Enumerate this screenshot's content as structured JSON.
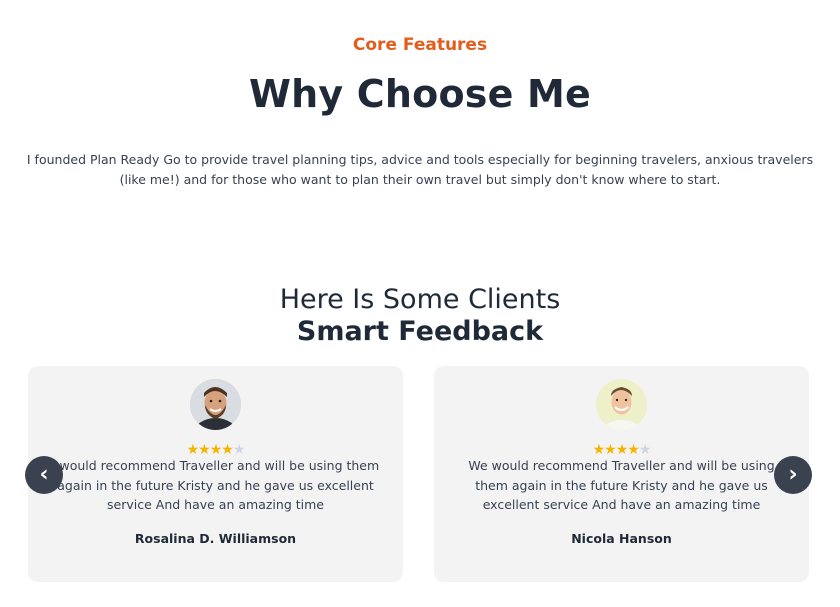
{
  "features": {
    "eyebrow": "Core Features",
    "title": "Why Choose Me",
    "description": "I founded Plan Ready Go to provide travel planning tips, advice and tools especially for beginning travelers, anxious travelers (like me!) and for those who want to plan their own travel but simply don't know where to start."
  },
  "testimonials": {
    "heading_light": "Here Is Some Clients",
    "heading_bold": "Smart Feedback",
    "prev_icon": "‹",
    "next_icon": "›",
    "cards": [
      {
        "name": "Rosalina D. Williamson",
        "rating": 4,
        "max_rating": 5,
        "quote": "I would recommend Traveller and will be using them again in the future Kristy and he gave us excellent service And have an amazing time"
      },
      {
        "name": "Nicola Hanson",
        "rating": 4,
        "max_rating": 5,
        "quote": "We would recommend Traveller and will be using them again in the future Kristy and he gave us excellent service And have an amazing time"
      }
    ]
  },
  "colors": {
    "accent": "#e35d1a",
    "star": "#f4b400",
    "star_empty": "#cfd6e3",
    "card_bg": "#f3f3f3",
    "arrow_bg": "#3a4250"
  }
}
